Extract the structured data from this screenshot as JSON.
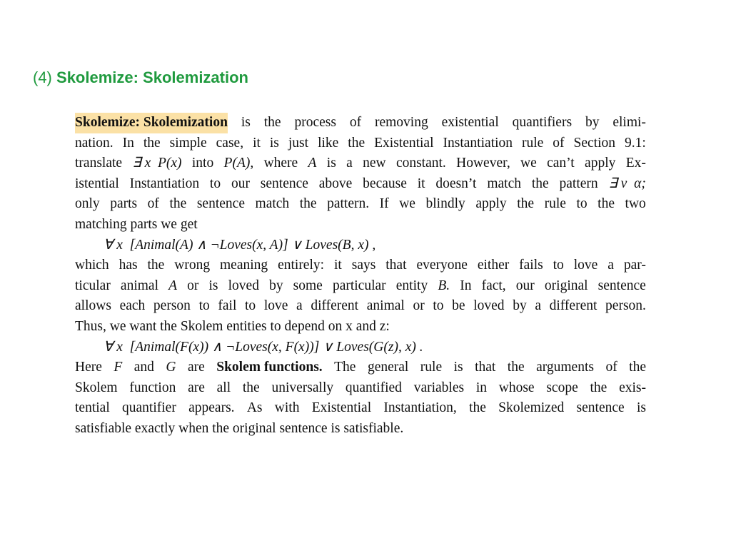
{
  "title": {
    "number": "(4)",
    "text": "Skolemize: Skolemization"
  },
  "para1": {
    "l1": [
      "Skolemize: Skolemization",
      "is",
      "the",
      "process",
      "of",
      "removing",
      "existential",
      "quantifiers",
      "by",
      "elimi-"
    ],
    "l2": [
      "nation.",
      "In",
      "the",
      "simple",
      "case,",
      "it",
      "is",
      "just",
      "like",
      "the",
      "Existential",
      "Instantiation",
      "rule",
      "of",
      "Section",
      "9.1:"
    ],
    "l3": [
      "translate",
      "∃ x  P(x)",
      "into",
      "P(A),",
      "where",
      "A",
      "is",
      "a",
      "new",
      "constant.",
      "However,",
      "we",
      "can’t",
      "apply",
      "Ex-"
    ],
    "l4": [
      "istential",
      "Instantiation",
      "to",
      "our",
      "sentence",
      "above",
      "because",
      "it",
      "doesn’t",
      "match",
      "the",
      "pattern",
      "∃ v  α;"
    ],
    "l5": [
      "only",
      "parts",
      "of",
      "the",
      "sentence",
      "match",
      "the",
      "pattern.",
      "If",
      "we",
      "blindly",
      "apply",
      "the",
      "rule",
      "to",
      "the",
      "two"
    ],
    "l6": "matching parts we get"
  },
  "formula1": "∀ x  [Animal(A) ∧ ¬Loves(x, A)] ∨ Loves(B, x) ,",
  "para2": {
    "l1": [
      "which",
      "has",
      "the",
      "wrong",
      "meaning",
      "entirely:",
      "it",
      "says",
      "that",
      "everyone",
      "either",
      "fails",
      "to",
      "love",
      "a",
      "par-"
    ],
    "l2": [
      "ticular",
      "animal",
      "A",
      "or",
      "is",
      "loved",
      "by",
      "some",
      "particular",
      "entity",
      "B.",
      "In",
      "fact,",
      "our",
      "original",
      "sentence"
    ],
    "l3": [
      "allows",
      "each",
      "person",
      "to",
      "fail",
      "to",
      "love",
      "a",
      "different",
      "animal",
      "or",
      "to",
      "be",
      "loved",
      "by",
      "a",
      "different",
      "person."
    ],
    "l4": "Thus, we want the Skolem entities to depend on x and z:"
  },
  "formula2": "∀ x  [Animal(F(x)) ∧ ¬Loves(x, F(x))] ∨ Loves(G(z), x) .",
  "para3": {
    "l1": [
      "Here",
      "F",
      "and",
      "G",
      "are",
      "Skolem functions.",
      "The",
      "general",
      "rule",
      "is",
      "that",
      "the",
      "arguments",
      "of",
      "the"
    ],
    "l2": [
      "Skolem",
      "function",
      "are",
      "all",
      "the",
      "universally",
      "quantified",
      "variables",
      "in",
      "whose",
      "scope",
      "the",
      "exis-"
    ],
    "l3": [
      "tential",
      "quantifier",
      "appears.",
      "As",
      "with",
      "Existential",
      "Instantiation,",
      "the",
      "Skolemized",
      "sentence",
      "is"
    ],
    "l4": "satisfiable exactly when the original sentence is satisfiable."
  },
  "colors": {
    "title": "#1f9a3e",
    "highlight": "#fbe1a6",
    "text": "#111111"
  }
}
